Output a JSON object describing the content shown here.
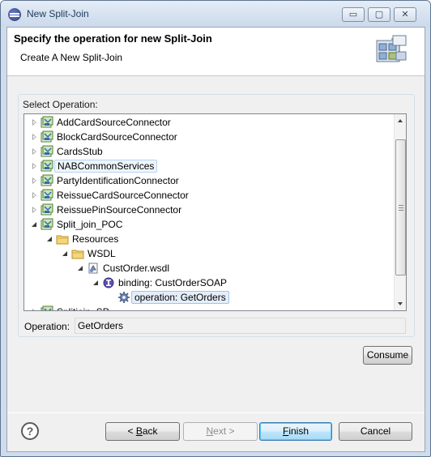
{
  "window": {
    "title": "New Split-Join",
    "minimize_glyph": "▭",
    "maximize_glyph": "▢",
    "close_glyph": "✕"
  },
  "header": {
    "title": "Specify the operation for new Split-Join",
    "subtitle": "Create A New Split-Join",
    "icon": "split-join-wizard-icon"
  },
  "select_operation": {
    "label": "Select Operation:",
    "tree": [
      {
        "label": "AddCardSourceConnector",
        "depth": 0,
        "expander": "closed",
        "icon": "project-icon"
      },
      {
        "label": "BlockCardSourceConnector",
        "depth": 0,
        "expander": "closed",
        "icon": "project-icon"
      },
      {
        "label": "CardsStub",
        "depth": 0,
        "expander": "closed",
        "icon": "project-icon"
      },
      {
        "label": "NABCommonServices",
        "depth": 0,
        "expander": "closed",
        "icon": "project-icon",
        "state": "hover"
      },
      {
        "label": "PartyIdentificationConnector",
        "depth": 0,
        "expander": "closed",
        "icon": "project-icon"
      },
      {
        "label": "ReissueCardSourceConnector",
        "depth": 0,
        "expander": "closed",
        "icon": "project-icon"
      },
      {
        "label": "ReissuePinSourceConnector",
        "depth": 0,
        "expander": "closed",
        "icon": "project-icon"
      },
      {
        "label": "Split_join_POC",
        "depth": 0,
        "expander": "open",
        "icon": "project-icon"
      },
      {
        "label": "Resources",
        "depth": 1,
        "expander": "open",
        "icon": "folder-icon"
      },
      {
        "label": "WSDL",
        "depth": 2,
        "expander": "open",
        "icon": "folder-icon"
      },
      {
        "label": "CustOrder.wsdl",
        "depth": 3,
        "expander": "open",
        "icon": "wsdl-file-icon"
      },
      {
        "label": "binding: CustOrderSOAP",
        "depth": 4,
        "expander": "open",
        "icon": "binding-icon"
      },
      {
        "label": "operation: GetOrders",
        "depth": 5,
        "expander": "none",
        "icon": "operation-gear-icon",
        "state": "selected"
      },
      {
        "label": "Splitjoin_SP",
        "depth": 0,
        "expander": "closed",
        "icon": "project-icon"
      }
    ]
  },
  "operation": {
    "label": "Operation:",
    "value": "GetOrders"
  },
  "buttons": {
    "consume": "Consume",
    "back_prefix": "< ",
    "back_key": "B",
    "back_rest": "ack",
    "next_key": "N",
    "next_rest": "ext >",
    "finish_key": "F",
    "finish_rest": "inish",
    "cancel": "Cancel",
    "help_glyph": "?"
  },
  "colors": {
    "window_frame": "#cfdcec",
    "dialog_bg": "#f0f0f0",
    "default_button_border": "#3c7fb1",
    "selection_bg": "#e4eefa"
  }
}
